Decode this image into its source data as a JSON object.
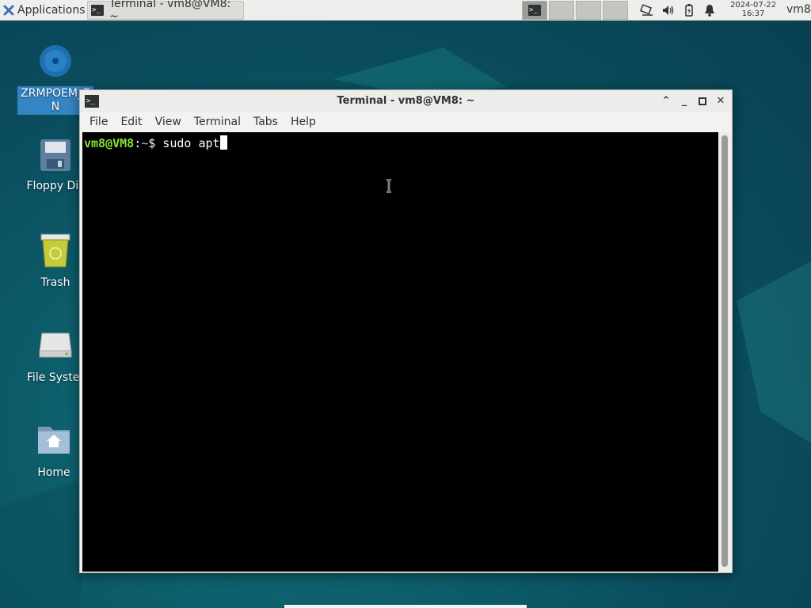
{
  "panel": {
    "applications_label": "Applications",
    "task_title": "Terminal - vm8@VM8: ~",
    "clock_date": "2024-07-22",
    "clock_time": "16:37",
    "user": "vm8"
  },
  "desktop": {
    "icons": [
      {
        "label": "ZRMPOEM_E N",
        "icon": "disc-icon"
      },
      {
        "label": "Floppy Dis",
        "icon": "floppy-icon"
      },
      {
        "label": "Trash",
        "icon": "trash-icon"
      },
      {
        "label": "File Syster",
        "icon": "drive-icon"
      },
      {
        "label": "Home",
        "icon": "home-folder-icon"
      }
    ]
  },
  "window": {
    "title": "Terminal - vm8@VM8: ~",
    "menu": [
      "File",
      "Edit",
      "View",
      "Terminal",
      "Tabs",
      "Help"
    ]
  },
  "terminal": {
    "prompt_user": "vm8@VM8",
    "prompt_sep": ":",
    "prompt_path": "~",
    "prompt_symbol": "$",
    "command": "sudo apt"
  },
  "colors": {
    "prompt_user": "#8ae234",
    "prompt_path": "#729fcf",
    "selection": "#3584c4"
  }
}
